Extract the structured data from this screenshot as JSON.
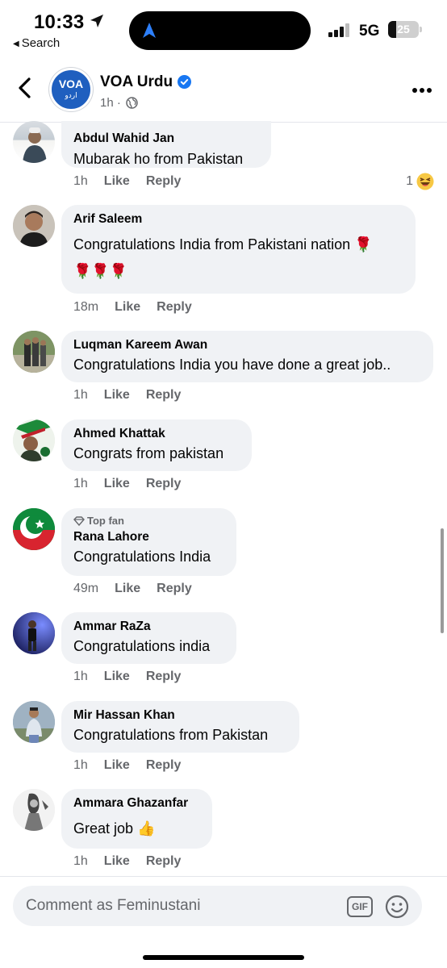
{
  "status_bar": {
    "time": "10:33",
    "back_app": "Search",
    "network": "5G",
    "battery": "25",
    "battery_level": 0.25
  },
  "header": {
    "page_name": "VOA Urdu",
    "avatar_text": "VOA",
    "avatar_subtext": "اردو",
    "meta": "1h ·",
    "icons": [
      "back-arrow-icon",
      "verified-badge-icon",
      "globe-icon",
      "more-icon"
    ]
  },
  "comments": [
    {
      "author": "Abdul Wahid Jan",
      "text": "Mubarak ho from Pakistan",
      "time": "1h",
      "like": "Like",
      "reply": "Reply",
      "reaction_count": "1",
      "reaction": "laughing-emoji"
    },
    {
      "author": "Arif Saleem",
      "text": "Congratulations India from Pakistani nation 🌹",
      "text2": "🌹🌹🌹",
      "time": "18m",
      "like": "Like",
      "reply": "Reply"
    },
    {
      "author": "Luqman Kareem Awan",
      "text": "Congratulations India you have done a great job..",
      "time": "1h",
      "like": "Like",
      "reply": "Reply"
    },
    {
      "author": "Ahmed Khattak",
      "text": "Congrats from pakistan",
      "time": "1h",
      "like": "Like",
      "reply": "Reply"
    },
    {
      "badge": "Top fan",
      "author": "Rana Lahore",
      "text": "Congratulations India",
      "time": "49m",
      "like": "Like",
      "reply": "Reply"
    },
    {
      "author": "Ammar RaZa",
      "text": "Congratulations india",
      "time": "1h",
      "like": "Like",
      "reply": "Reply"
    },
    {
      "author": "Mir Hassan Khan",
      "text": "Congratulations from Pakistan",
      "time": "1h",
      "like": "Like",
      "reply": "Reply"
    },
    {
      "author": "Ammara Ghazanfar",
      "text": "Great job 👍",
      "time": "1h",
      "like": "Like",
      "reply": "Reply"
    }
  ],
  "composer": {
    "placeholder": "Comment as Feminustani",
    "gif_label": "GIF"
  },
  "colors": {
    "bubble": "#f0f2f5",
    "meta": "#65676b",
    "verified": "#1877f2",
    "brand": "#1f5fbf"
  }
}
